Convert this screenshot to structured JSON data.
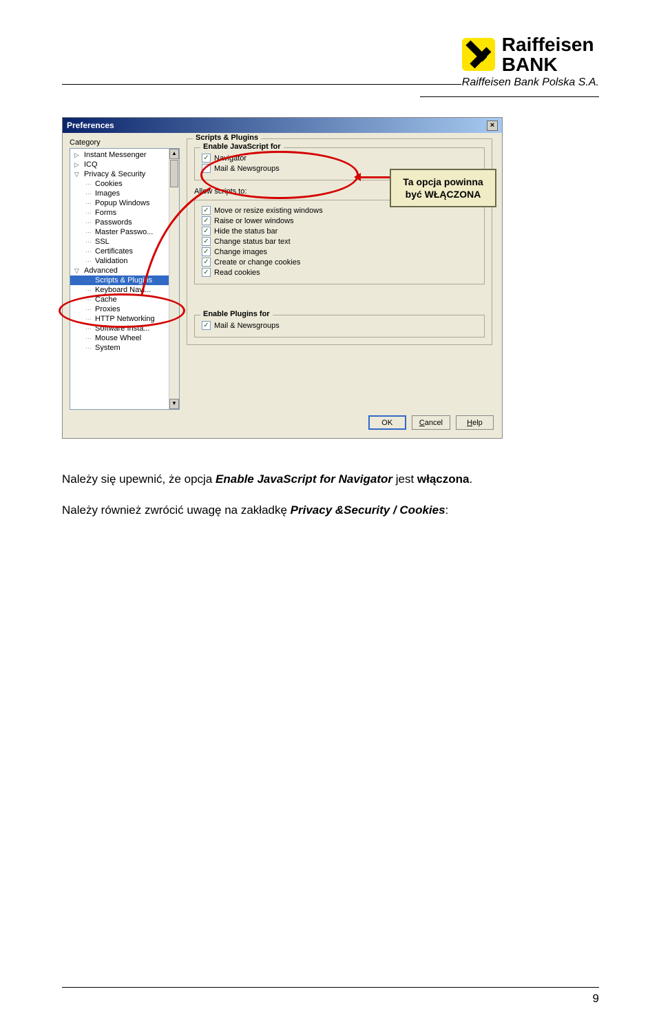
{
  "brand": {
    "name1": "Raiffeisen",
    "name2": "BANK",
    "sub": "Raiffeisen Bank Polska S.A."
  },
  "dialog": {
    "title": "Preferences",
    "close": "×",
    "sidebarLabel": "Category",
    "tree": [
      {
        "label": "Instant Messenger",
        "indent": false,
        "expander": "▷"
      },
      {
        "label": "ICQ",
        "indent": false,
        "expander": "▷"
      },
      {
        "label": "Privacy & Security",
        "indent": false,
        "expander": "▽"
      },
      {
        "label": "Cookies",
        "indent": true
      },
      {
        "label": "Images",
        "indent": true
      },
      {
        "label": "Popup Windows",
        "indent": true
      },
      {
        "label": "Forms",
        "indent": true
      },
      {
        "label": "Passwords",
        "indent": true
      },
      {
        "label": "Master Passwo...",
        "indent": true
      },
      {
        "label": "SSL",
        "indent": true
      },
      {
        "label": "Certificates",
        "indent": true
      },
      {
        "label": "Validation",
        "indent": true
      },
      {
        "label": "Advanced",
        "indent": false,
        "expander": "▽"
      },
      {
        "label": "Scripts & Plugins",
        "indent": true,
        "selected": true
      },
      {
        "label": "Keyboard Navi...",
        "indent": true
      },
      {
        "label": "Cache",
        "indent": true
      },
      {
        "label": "Proxies",
        "indent": true
      },
      {
        "label": "HTTP Networking",
        "indent": true
      },
      {
        "label": "Software Insta...",
        "indent": true
      },
      {
        "label": "Mouse Wheel",
        "indent": true
      },
      {
        "label": "System",
        "indent": true
      }
    ],
    "panelTitle": "Scripts & Plugins",
    "enableJsGroup": "Enable JavaScript for",
    "jsOptions": [
      {
        "label": "Navigator",
        "checked": true
      },
      {
        "label": "Mail & Newsgroups",
        "checked": false
      }
    ],
    "allowLabel": "Allow scripts to:",
    "allowOptions": [
      {
        "label": "Move or resize existing windows",
        "checked": true
      },
      {
        "label": "Raise or lower windows",
        "checked": true
      },
      {
        "label": "Hide the status bar",
        "checked": true
      },
      {
        "label": "Change status bar text",
        "checked": true
      },
      {
        "label": "Change images",
        "checked": true
      },
      {
        "label": "Create or change cookies",
        "checked": true
      },
      {
        "label": "Read cookies",
        "checked": true
      }
    ],
    "pluginsGroup": "Enable Plugins for",
    "pluginsOptions": [
      {
        "label": "Mail & Newsgroups",
        "checked": true
      }
    ],
    "buttons": {
      "ok": "OK",
      "cancel": "Cancel",
      "help": "Help"
    }
  },
  "callout": {
    "line1": "Ta opcja powinna",
    "line2": "być WŁĄCZONA"
  },
  "bodyText": {
    "p1_a": "Należy się upewnić, że opcja ",
    "p1_b": "Enable JavaScript for Navigator",
    "p1_c": "  jest ",
    "p1_d": "włączona",
    "p1_e": ".",
    "p2_a": "Należy również zwrócić uwagę na zakładkę ",
    "p2_b": "Privacy &Security / Cookies",
    "p2_c": ":"
  },
  "pageNumber": "9"
}
